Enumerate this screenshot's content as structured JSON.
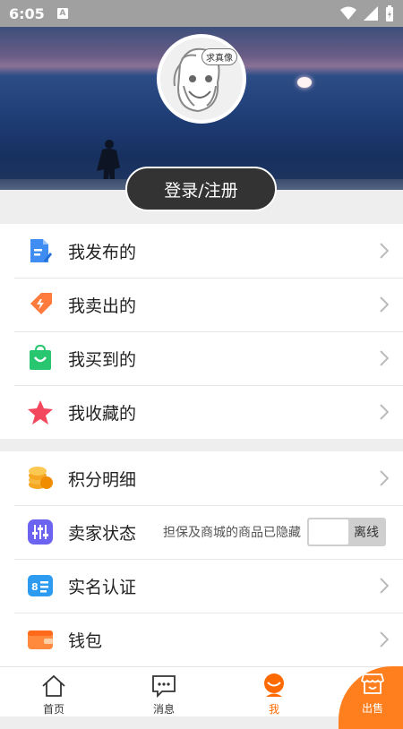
{
  "status_bar": {
    "time": "6:05",
    "notification_glyph": "A"
  },
  "header": {
    "avatar_caption": "求真像",
    "login_label": "登录/注册"
  },
  "menu_group_1": [
    {
      "label": "我发布的",
      "icon": "document-edit-icon"
    },
    {
      "label": "我卖出的",
      "icon": "tag-icon"
    },
    {
      "label": "我买到的",
      "icon": "shopping-bag-icon"
    },
    {
      "label": "我收藏的",
      "icon": "star-icon"
    }
  ],
  "menu_group_2": {
    "points": {
      "label": "积分明细",
      "icon": "coins-icon"
    },
    "seller_status": {
      "label": "卖家状态",
      "note": "担保及商城的商品已隐藏",
      "toggle_text": "离线"
    },
    "real_name": {
      "label": "实名认证",
      "icon": "id-card-icon"
    },
    "wallet": {
      "label": "钱包",
      "icon": "wallet-icon"
    }
  },
  "tabs": [
    {
      "label": "首页",
      "icon": "home-icon"
    },
    {
      "label": "消息",
      "icon": "message-icon"
    },
    {
      "label": "我",
      "icon": "user-icon",
      "active": true
    },
    {
      "label": "出售",
      "icon": "store-icon"
    }
  ],
  "colors": {
    "accent": "#ff6a00",
    "sell_bg": "#ff7f1f",
    "button_dark": "#333333"
  }
}
